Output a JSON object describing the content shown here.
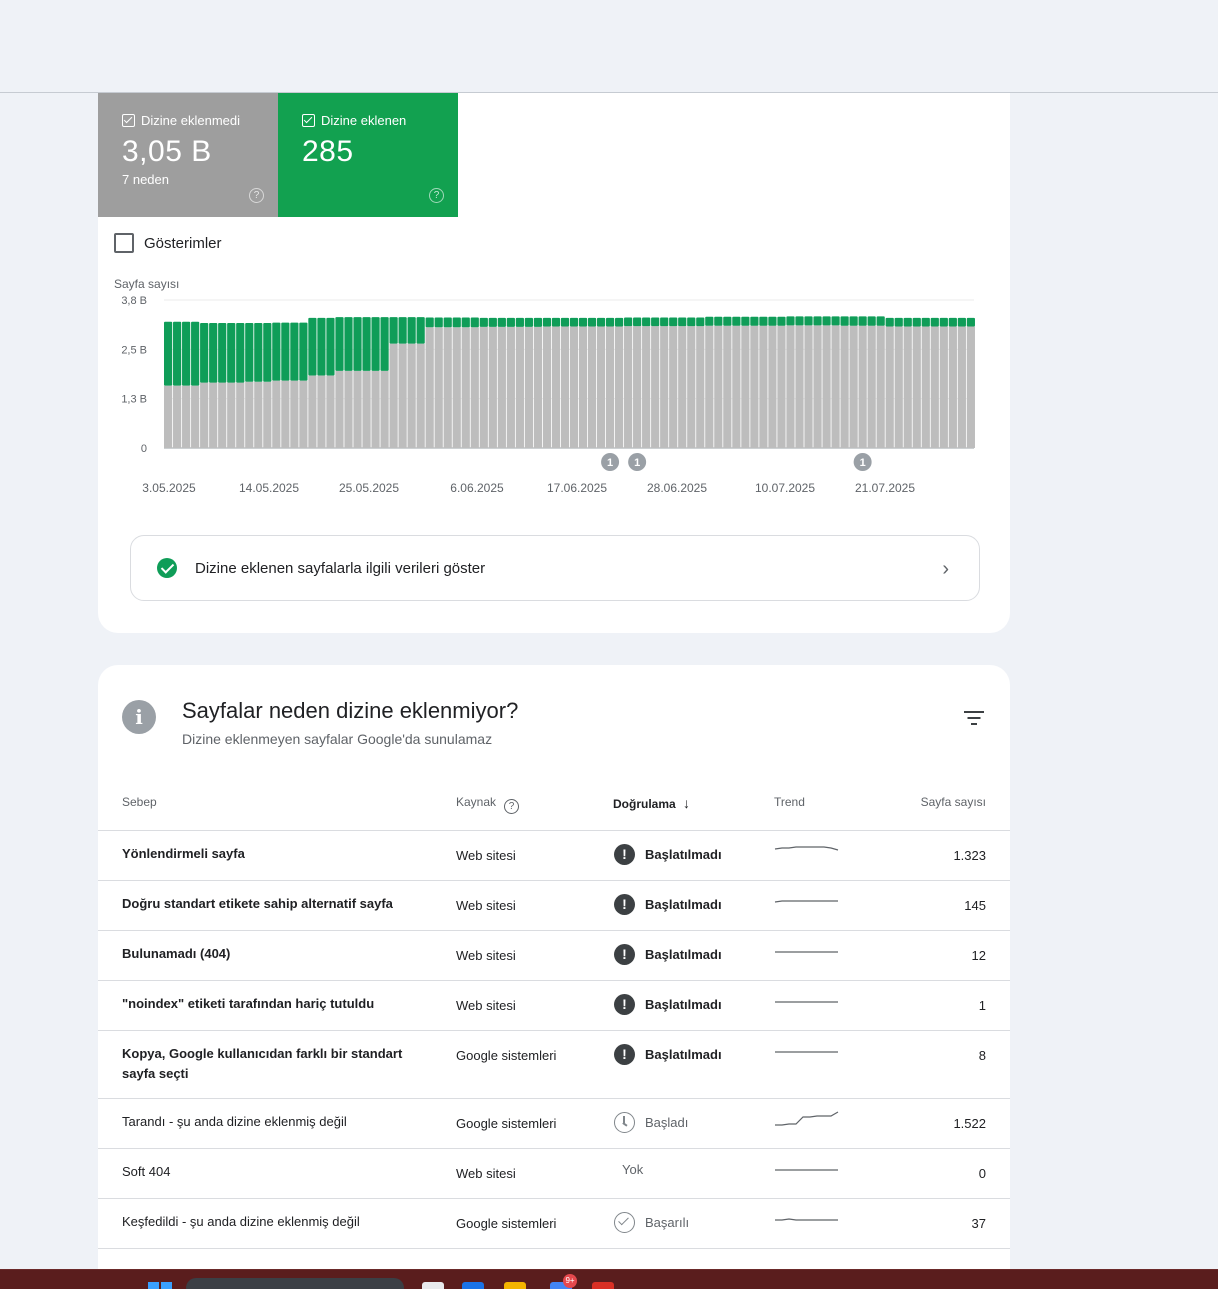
{
  "tiles": {
    "not_indexed": {
      "label": "Dizine eklenmedi",
      "value": "3,05 B",
      "sub": "7 neden",
      "color": "#9e9e9e"
    },
    "indexed": {
      "label": "Dizine eklenen",
      "value": "285",
      "color": "#12a150"
    }
  },
  "impressions_label": "Gösterimler",
  "chart_data": {
    "type": "bar",
    "stacked": true,
    "ylabel": "Sayfa sayısı",
    "y_ticks": [
      "0",
      "1,3 B",
      "2,5 B",
      "3,8 B"
    ],
    "ylim": [
      0,
      3800
    ],
    "x_tick_labels": [
      "3.05.2025",
      "14.05.2025",
      "25.05.2025",
      "6.06.2025",
      "17.06.2025",
      "28.06.2025",
      "10.07.2025",
      "21.07.2025"
    ],
    "annotations": [
      {
        "label": "1",
        "bar_index": 49
      },
      {
        "label": "1",
        "bar_index": 52
      },
      {
        "label": "1",
        "bar_index": 77
      }
    ],
    "series": [
      {
        "color": "#bdbdbd",
        "values": [
          1600,
          1600,
          1600,
          1600,
          1680,
          1680,
          1680,
          1680,
          1680,
          1700,
          1700,
          1700,
          1730,
          1730,
          1730,
          1730,
          1860,
          1860,
          1860,
          1980,
          1980,
          1980,
          1980,
          1980,
          1980,
          2680,
          2680,
          2680,
          2680,
          3100,
          3100,
          3100,
          3100,
          3100,
          3100,
          3110,
          3110,
          3110,
          3110,
          3110,
          3110,
          3110,
          3120,
          3120,
          3120,
          3120,
          3120,
          3120,
          3120,
          3120,
          3120,
          3130,
          3130,
          3130,
          3130,
          3130,
          3130,
          3130,
          3130,
          3130,
          3140,
          3140,
          3140,
          3140,
          3140,
          3140,
          3140,
          3140,
          3140,
          3150,
          3150,
          3150,
          3150,
          3150,
          3150,
          3140,
          3140,
          3140,
          3140,
          3140,
          3120,
          3120,
          3120,
          3120,
          3120,
          3120,
          3120,
          3120,
          3120,
          3120
        ]
      },
      {
        "color": "#0f9d58",
        "values": [
          1640,
          1640,
          1640,
          1640,
          1530,
          1530,
          1530,
          1530,
          1530,
          1510,
          1510,
          1510,
          1490,
          1490,
          1490,
          1490,
          1480,
          1480,
          1480,
          1380,
          1380,
          1380,
          1380,
          1380,
          1380,
          680,
          680,
          680,
          680,
          250,
          250,
          250,
          250,
          250,
          250,
          230,
          230,
          230,
          230,
          230,
          230,
          230,
          220,
          220,
          220,
          220,
          220,
          220,
          220,
          220,
          220,
          220,
          220,
          220,
          220,
          220,
          220,
          220,
          220,
          220,
          230,
          230,
          230,
          230,
          230,
          230,
          230,
          230,
          230,
          230,
          230,
          230,
          230,
          230,
          230,
          240,
          240,
          240,
          240,
          240,
          220,
          220,
          220,
          220,
          220,
          220,
          220,
          220,
          220,
          220
        ]
      }
    ]
  },
  "cta": {
    "label": "Dizine eklenen sayfalarla ilgili verileri göster"
  },
  "reasons": {
    "title": "Sayfalar neden dizine eklenmiyor?",
    "subtitle": "Dizine eklenmeyen sayfalar Google'da sunulamaz",
    "columns": {
      "reason": "Sebep",
      "source": "Kaynak",
      "validation": "Doğrulama",
      "trend": "Trend",
      "count": "Sayfa sayısı"
    },
    "rows": [
      {
        "reason": "Yönlendirmeli sayfa",
        "source": "Web sitesi",
        "validation": "Başlatılmadı",
        "status": "error",
        "count": "1.323",
        "bold": true,
        "trend": [
          8,
          7,
          7,
          6,
          6,
          6,
          6,
          6,
          7,
          9
        ]
      },
      {
        "reason": "Doğru standart etikete sahip alternatif sayfa",
        "source": "Web sitesi",
        "validation": "Başlatılmadı",
        "status": "error",
        "count": "145",
        "bold": true,
        "trend": [
          11,
          10,
          10,
          10,
          10,
          10,
          10,
          10,
          10,
          10
        ]
      },
      {
        "reason": "Bulunamadı (404)",
        "source": "Web sitesi",
        "validation": "Başlatılmadı",
        "status": "error",
        "count": "12",
        "bold": true,
        "trend": [
          11,
          11,
          11,
          11,
          11,
          11,
          11,
          11,
          11,
          11
        ]
      },
      {
        "reason": "\"noindex\" etiketi tarafından hariç tutuldu",
        "source": "Web sitesi",
        "validation": "Başlatılmadı",
        "status": "error",
        "count": "1",
        "bold": true,
        "trend": [
          11,
          11,
          11,
          11,
          11,
          11,
          11,
          11,
          11,
          11
        ]
      },
      {
        "reason": "Kopya, Google kullanıcıdan farklı bir standart sayfa seçti",
        "source": "Google sistemleri",
        "validation": "Başlatılmadı",
        "status": "error",
        "count": "8",
        "bold": true,
        "trend": [
          11,
          11,
          11,
          11,
          11,
          11,
          11,
          11,
          11,
          11
        ]
      },
      {
        "reason": "Tarandı - şu anda dizine eklenmiş değil",
        "source": "Google sistemleri",
        "validation": "Başladı",
        "status": "started",
        "count": "1.522",
        "bold": false,
        "trend": [
          16,
          16,
          15,
          15,
          8,
          8,
          7,
          7,
          7,
          3
        ]
      },
      {
        "reason": "Soft 404",
        "source": "Web sitesi",
        "validation": "Yok",
        "status": "none",
        "count": "0",
        "bold": false,
        "trend": [
          11,
          11,
          11,
          11,
          11,
          11,
          11,
          11,
          11,
          11
        ]
      },
      {
        "reason": "Keşfedildi - şu anda dizine eklenmiş değil",
        "source": "Google sistemleri",
        "validation": "Başarılı",
        "status": "passed",
        "count": "37",
        "bold": false,
        "trend": [
          11,
          11,
          10,
          11,
          11,
          11,
          11,
          11,
          11,
          11
        ]
      }
    ]
  },
  "taskbar": {
    "badge": "9+"
  }
}
